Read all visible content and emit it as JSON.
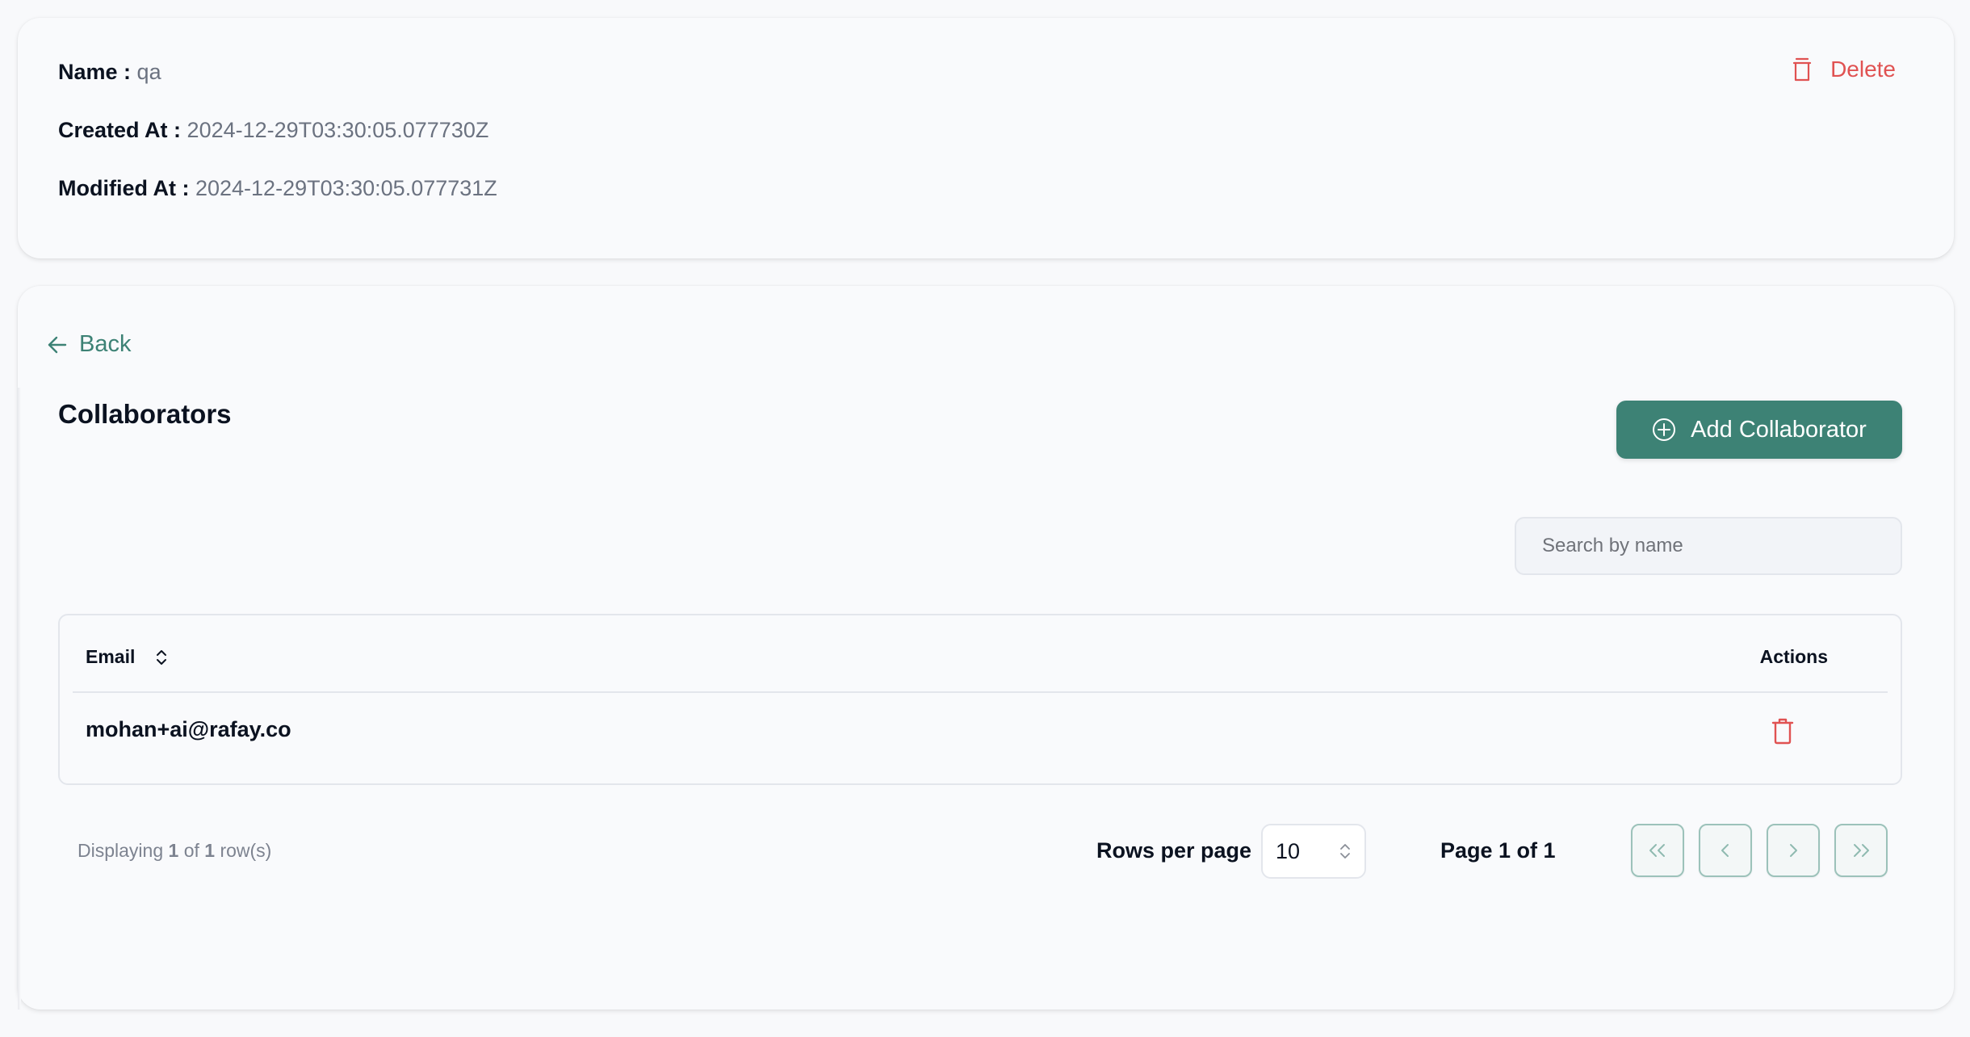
{
  "info": {
    "name_label": "Name :",
    "name_value": "qa",
    "created_label": "Created At :",
    "created_value": "2024-12-29T03:30:05.077730Z",
    "modified_label": "Modified At :",
    "modified_value": "2024-12-29T03:30:05.077731Z",
    "delete_label": "Delete"
  },
  "nav": {
    "back_label": "Back"
  },
  "collaborators": {
    "title": "Collaborators",
    "add_button_label": "Add Collaborator",
    "search_placeholder": "Search by name",
    "search_value": "",
    "table": {
      "columns": [
        "Email",
        "Actions"
      ],
      "rows": [
        {
          "email": "mohan+ai@rafay.co"
        }
      ]
    },
    "pagination": {
      "displaying_prefix": "Displaying",
      "displayed": "1",
      "of_word": "of",
      "total": "1",
      "rows_suffix": "row(s)",
      "rows_per_page_label": "Rows per page",
      "rows_per_page_value": "10",
      "page_info": "Page 1 of 1"
    }
  },
  "colors": {
    "accent": "#3d8275",
    "danger": "#e05252",
    "background": "#f8f9fb"
  },
  "icons": {
    "delete": "trash-icon",
    "back": "arrow-left-icon",
    "add": "plus-circle-icon",
    "sort": "chevron-up-down-icon",
    "first": "chevrons-left-icon",
    "prev": "chevron-left-icon",
    "next": "chevron-right-icon",
    "last": "chevrons-right-icon"
  }
}
